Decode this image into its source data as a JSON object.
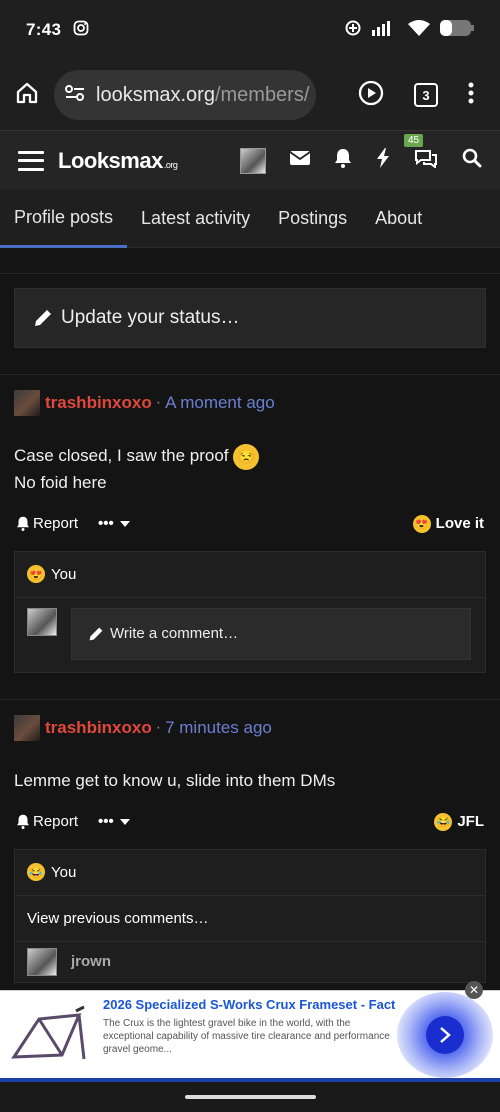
{
  "status_bar": {
    "time": "7:43"
  },
  "browser": {
    "url_host": "looksmax.org",
    "url_path": "/members/",
    "tab_count": "3"
  },
  "site": {
    "logo": "Looksmax",
    "logo_suffix": ".org",
    "notification_badge": "45"
  },
  "tabs": [
    {
      "label": "Profile posts"
    },
    {
      "label": "Latest activity"
    },
    {
      "label": "Postings"
    },
    {
      "label": "About"
    }
  ],
  "status_update": {
    "placeholder": "Update your status…"
  },
  "posts": [
    {
      "username": "trashbinxoxo",
      "time": "A moment ago",
      "text_line1": "Case closed, I saw the proof",
      "text_line2": "No foid here",
      "report_label": "Report",
      "reaction_label": "Love it",
      "reacted_by": "You",
      "comment_placeholder": "Write a comment…"
    },
    {
      "username": "trashbinxoxo",
      "time": "7 minutes ago",
      "text_line1": "Lemme get to know u, slide into them DMs",
      "report_label": "Report",
      "reaction_label": "JFL",
      "reacted_by": "You",
      "view_previous": "View previous comments…",
      "commenter": "jrown"
    }
  ],
  "ad": {
    "title": "2026 Specialized S-Works Crux Frameset - Fact",
    "description": "The Crux is the lightest gravel bike in the world, with the exceptional capability of massive tire clearance and performance gravel geome...",
    "close_label": "✕"
  }
}
